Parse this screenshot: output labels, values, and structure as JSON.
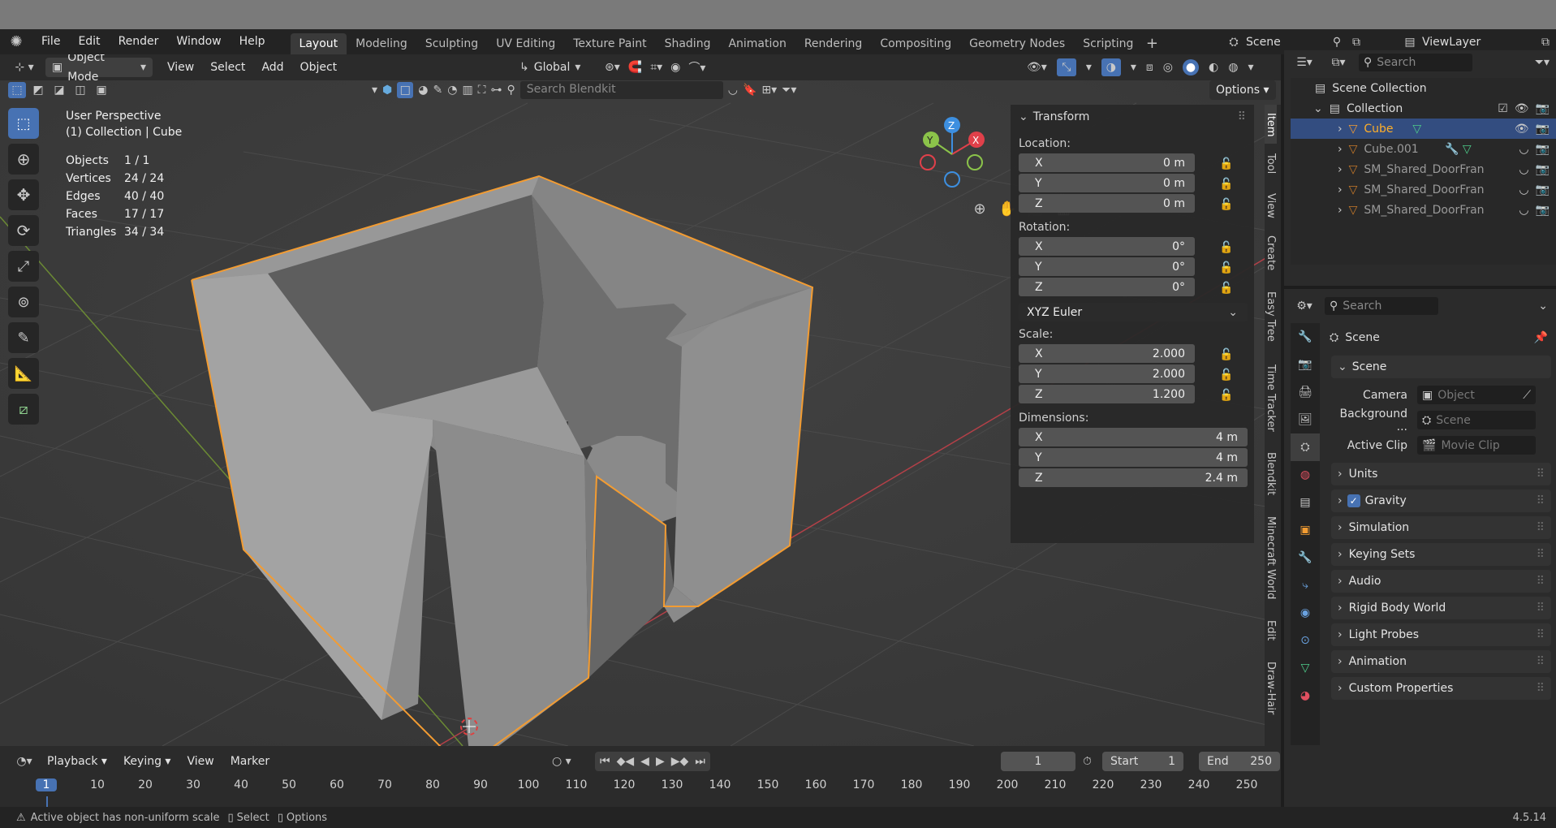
{
  "menus": [
    "File",
    "Edit",
    "Render",
    "Window",
    "Help"
  ],
  "workspaces": [
    "Layout",
    "Modeling",
    "Sculpting",
    "UV Editing",
    "Texture Paint",
    "Shading",
    "Animation",
    "Rendering",
    "Compositing",
    "Geometry Nodes",
    "Scripting"
  ],
  "active_workspace": "Layout",
  "scene_name": "Scene",
  "view_layer": "ViewLayer",
  "header": {
    "mode": "Object Mode",
    "menus": [
      "View",
      "Select",
      "Add",
      "Object"
    ],
    "orientation": "Global",
    "search_placeholder": "Search Blendkit",
    "options": "Options"
  },
  "overlay": {
    "view_name": "User Perspective",
    "collection_line": "(1) Collection | Cube",
    "stats": [
      {
        "label": "Objects",
        "value": "1 / 1"
      },
      {
        "label": "Vertices",
        "value": "24 / 24"
      },
      {
        "label": "Edges",
        "value": "40 / 40"
      },
      {
        "label": "Faces",
        "value": "17 / 17"
      },
      {
        "label": "Triangles",
        "value": "34 / 34"
      }
    ]
  },
  "transform": {
    "title": "Transform",
    "location_label": "Location:",
    "location": [
      {
        "axis": "X",
        "value": "0 m"
      },
      {
        "axis": "Y",
        "value": "0 m"
      },
      {
        "axis": "Z",
        "value": "0 m"
      }
    ],
    "rotation_label": "Rotation:",
    "rotation": [
      {
        "axis": "X",
        "value": "0°"
      },
      {
        "axis": "Y",
        "value": "0°"
      },
      {
        "axis": "Z",
        "value": "0°"
      }
    ],
    "rotation_mode": "XYZ Euler",
    "scale_label": "Scale:",
    "scale": [
      {
        "axis": "X",
        "value": "2.000"
      },
      {
        "axis": "Y",
        "value": "2.000"
      },
      {
        "axis": "Z",
        "value": "1.200"
      }
    ],
    "dimensions_label": "Dimensions:",
    "dimensions": [
      {
        "axis": "X",
        "value": "4 m"
      },
      {
        "axis": "Y",
        "value": "4 m"
      },
      {
        "axis": "Z",
        "value": "2.4 m"
      }
    ]
  },
  "side_tabs": [
    "Item",
    "Tool",
    "View",
    "Create",
    "Easy Tree",
    "Time Tracker",
    "Blendkit",
    "Minecraft World",
    "Edit",
    "Draw-Hair"
  ],
  "outliner": {
    "search_placeholder": "Search",
    "root": "Scene Collection",
    "collection": "Collection",
    "items": [
      {
        "name": "Cube",
        "selected": true
      },
      {
        "name": "Cube.001",
        "selected": false
      },
      {
        "name": "SM_Shared_DoorFran",
        "selected": false
      },
      {
        "name": "SM_Shared_DoorFran",
        "selected": false
      },
      {
        "name": "SM_Shared_DoorFran",
        "selected": false
      }
    ]
  },
  "properties": {
    "search_placeholder": "Search",
    "context": "Scene",
    "panel": "Scene",
    "fields": [
      {
        "label": "Camera",
        "value": "Object"
      },
      {
        "label": "Background ...",
        "value": "Scene"
      },
      {
        "label": "Active Clip",
        "value": "Movie Clip"
      }
    ],
    "sections": [
      "Units",
      "Gravity",
      "Simulation",
      "Keying Sets",
      "Audio",
      "Rigid Body World",
      "Light Probes",
      "Animation",
      "Custom Properties"
    ]
  },
  "timeline": {
    "menus": [
      "Playback",
      "Keying",
      "View",
      "Marker"
    ],
    "current_frame": "1",
    "start_label": "Start",
    "start": "1",
    "end_label": "End",
    "end": "250",
    "ticks": [
      "1",
      "10",
      "20",
      "30",
      "40",
      "50",
      "60",
      "70",
      "80",
      "90",
      "100",
      "110",
      "120",
      "130",
      "140",
      "150",
      "160",
      "170",
      "180",
      "190",
      "200",
      "210",
      "220",
      "230",
      "240",
      "250"
    ]
  },
  "status": {
    "warning": "Active object has non-uniform scale",
    "select": "Select",
    "options": "Options",
    "version": "4.5.14"
  },
  "colors": {
    "selection": "#f39c32",
    "x_axis": "#e0404a",
    "y_axis": "#8bc34a",
    "z_axis": "#3d8fe0",
    "active_tab": "#3a3a3a"
  }
}
